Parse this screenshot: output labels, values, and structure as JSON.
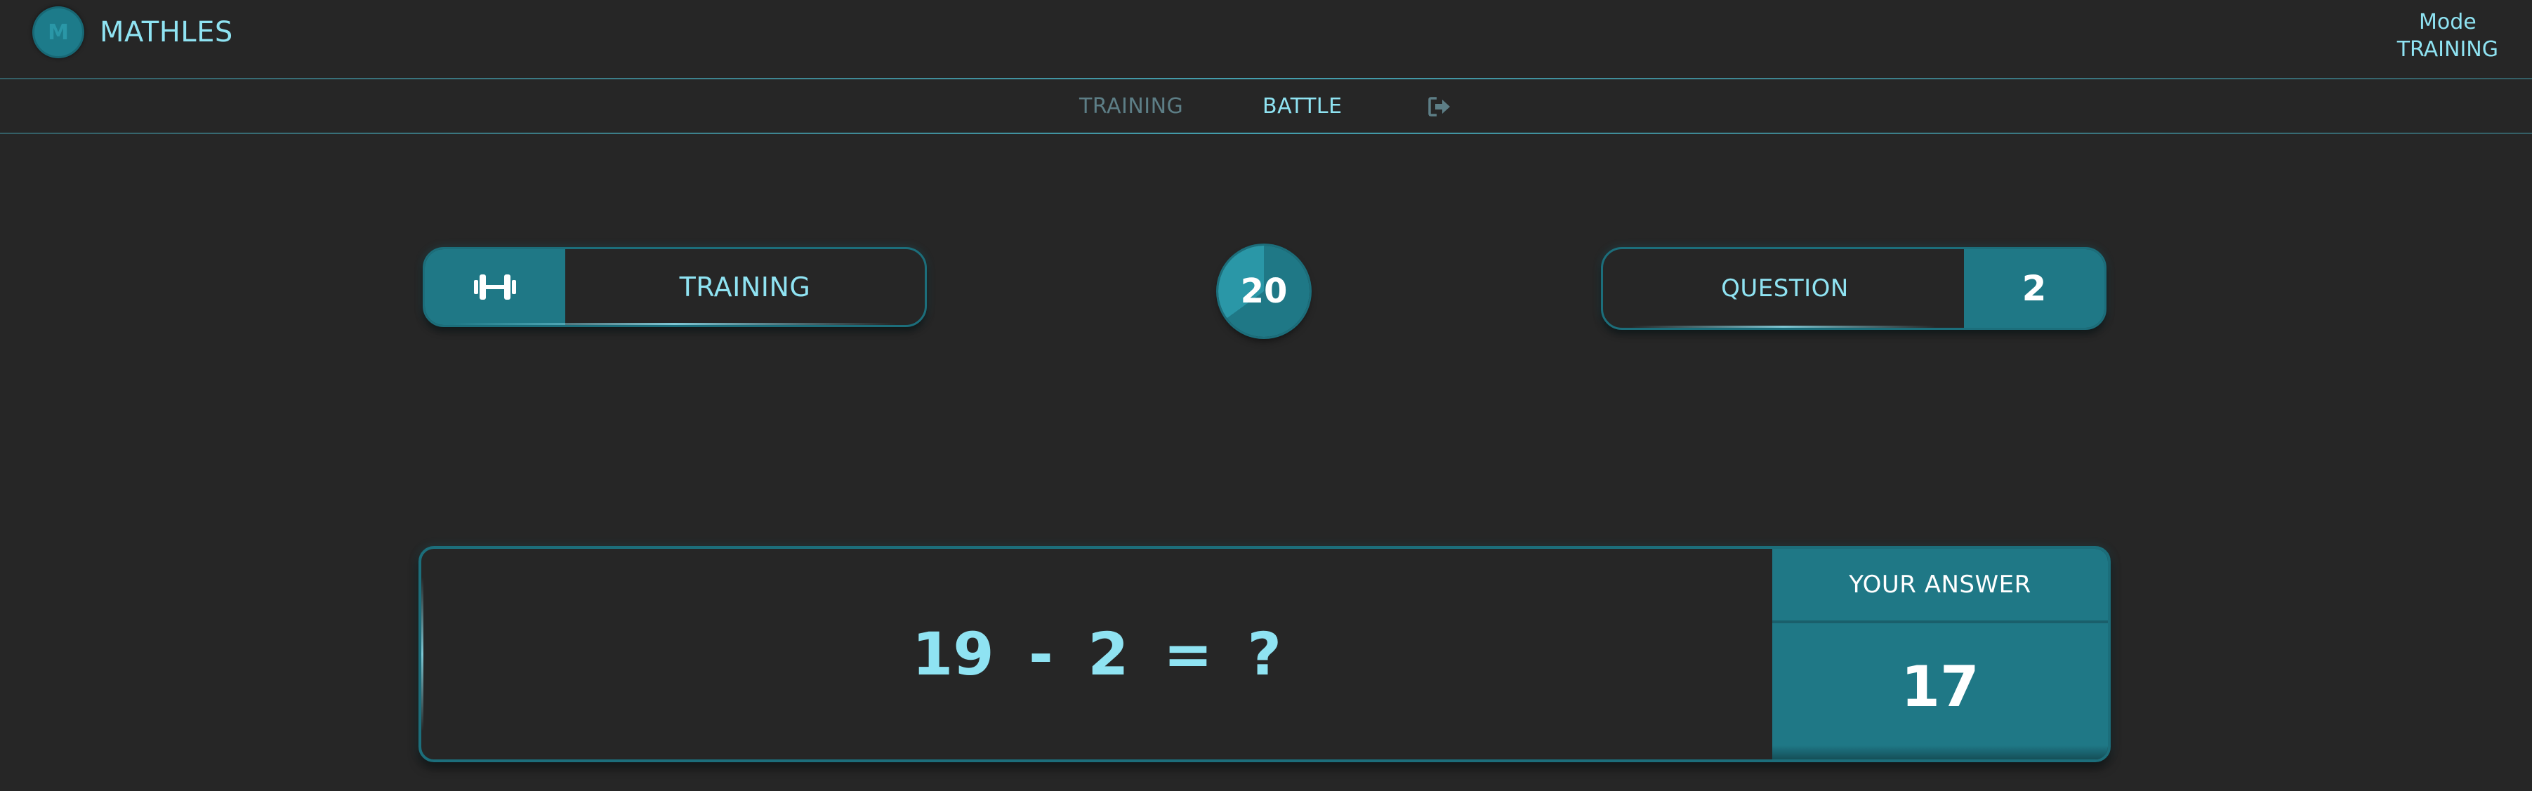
{
  "app": {
    "logo_letter": "M",
    "name": "MATHLES"
  },
  "mode_indicator": {
    "label": "Mode",
    "value": "TRAINING"
  },
  "nav": {
    "items": [
      {
        "label": "TRAINING",
        "active": false
      },
      {
        "label": "BATTLE",
        "active": true
      }
    ],
    "exit_icon": "sign-out-icon"
  },
  "mode_pill": {
    "icon": "dumbbell-icon",
    "label": "TRAINING"
  },
  "timer": {
    "seconds": "20",
    "remaining_fraction": 0.65
  },
  "question": {
    "label": "QUESTION",
    "number": "2"
  },
  "equation": {
    "text": "19 - 2 = ?"
  },
  "answer": {
    "header": "YOUR ANSWER",
    "value": "17"
  },
  "colors": {
    "background": "#262626",
    "accent": "#1f7886",
    "text_accent": "#8fe3f2",
    "muted": "#5d7e86"
  }
}
